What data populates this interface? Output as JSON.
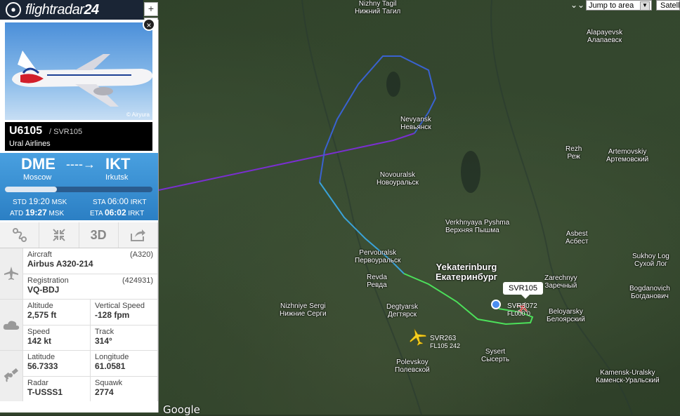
{
  "app": {
    "logo_text": "flightradar",
    "logo_num": "24"
  },
  "map_controls": {
    "zoom_in": "+",
    "zoom_out": "–",
    "jump_label": "Jump to area",
    "jump_arrow": "▼",
    "map_type": "Satellite",
    "chevron": "⌄⌄"
  },
  "photo": {
    "credit": "© Airyura"
  },
  "close_label": "×",
  "flight": {
    "number": "U6105",
    "callsign": "/ SVR105",
    "airline": "Ural Airlines"
  },
  "route": {
    "from_code": "DME",
    "from_city": "Moscow",
    "to_code": "IKT",
    "to_city": "Irkutsk",
    "arrow": "----→",
    "progress": 0.35,
    "std_label": "STD",
    "std_time": "19:20",
    "std_tz": "MSK",
    "atd_label": "ATD",
    "atd_time": "19:27",
    "atd_tz": "MSK",
    "sta_label": "STA",
    "sta_time": "06:00",
    "sta_tz": "IRKT",
    "eta_label": "ETA",
    "eta_time": "06:02",
    "eta_tz": "IRKT"
  },
  "tools": {
    "route_icon": "route-icon",
    "collapse_icon": "collapse-icon",
    "view3d": "3D",
    "share_icon": "share-icon"
  },
  "details": {
    "aircraft_label": "Aircraft",
    "aircraft": "Airbus A320-214",
    "aircraft_code": "(A320)",
    "reg_label": "Registration",
    "registration": "VQ-BDJ",
    "reg_code": "(424931)",
    "alt_label": "Altitude",
    "altitude": "2,575 ft",
    "vs_label": "Vertical Speed",
    "vertical_speed": "-128 fpm",
    "speed_label": "Speed",
    "speed": "142 kt",
    "track_label": "Track",
    "track": "314°",
    "lat_label": "Latitude",
    "latitude": "56.7333",
    "lon_label": "Longitude",
    "longitude": "61.0581",
    "radar_label": "Radar",
    "radar": "T-USSS1",
    "squawk_label": "Squawk",
    "squawk": "2774"
  },
  "cities": [
    {
      "en": "Nizhny Tagil",
      "ru": "Нижний Тагил"
    },
    {
      "en": "Alapayevsk",
      "ru": "Алапаевск"
    },
    {
      "en": "Nevyansk",
      "ru": "Невьянск"
    },
    {
      "en": "Rezh",
      "ru": "Реж"
    },
    {
      "en": "Artemovskiy",
      "ru": "Артемовский"
    },
    {
      "en": "Novouralsk",
      "ru": "Новоуральск"
    },
    {
      "en": "Verkhnyaya Pyshma",
      "ru": "Верхняя Пышма"
    },
    {
      "en": "Asbest",
      "ru": "Асбест"
    },
    {
      "en": "Pervouralsk",
      "ru": "Первоуральск"
    },
    {
      "en": "Yekaterinburg",
      "ru": "Екатеринбург"
    },
    {
      "en": "Sukhoy Log",
      "ru": "Сухой Лог"
    },
    {
      "en": "Revda",
      "ru": "Ревда"
    },
    {
      "en": "Zarechnyy",
      "ru": "Заречный"
    },
    {
      "en": "Bogdanovich",
      "ru": "Богданович"
    },
    {
      "en": "Degtyarsk",
      "ru": "Дегтярск"
    },
    {
      "en": "Nizhniye Sergi",
      "ru": "Нижние Серги"
    },
    {
      "en": "Beloyarsky",
      "ru": "Белоярский"
    },
    {
      "en": "Sysert",
      "ru": "Сысерть"
    },
    {
      "en": "Polevskoy",
      "ru": "Полевской"
    },
    {
      "en": "Kamensk-Uralsky",
      "ru": "Каменск-Уральский"
    }
  ],
  "aircraft_labels": [
    {
      "callsign": "SVR263",
      "detail": "FL105 242"
    },
    {
      "callsign": "SVR3072",
      "detail": "FL000 0"
    }
  ],
  "selected_bubble": "SVR105",
  "google": "Google"
}
